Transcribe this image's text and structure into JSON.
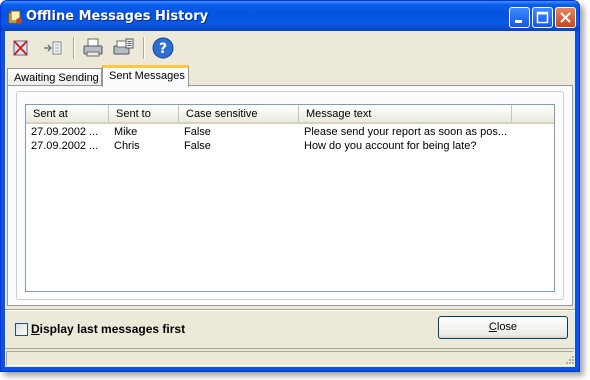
{
  "window": {
    "title": "Offline Messages History"
  },
  "tabs": [
    {
      "label": "Awaiting Sending",
      "active": false
    },
    {
      "label": "Sent Messages",
      "active": true
    }
  ],
  "table": {
    "columns": [
      "Sent at",
      "Sent to",
      "Case sensitive",
      "Message text"
    ],
    "rows": [
      [
        "27.09.2002 ...",
        "Mike",
        "False",
        "Please send your report as soon as pos..."
      ],
      [
        "27.09.2002 ...",
        "Chris",
        "False",
        "How do you account for being late?"
      ]
    ]
  },
  "options": {
    "display_last_first": {
      "label": "Display last messages first",
      "checked": false
    }
  },
  "buttons": {
    "close": "Close"
  },
  "toolbar": {
    "icons": [
      "delete-icon",
      "resend-icon",
      "print-icon",
      "print-setup-icon",
      "help-icon"
    ]
  },
  "colors": {
    "titlebar": "#0A5EEB",
    "tab_highlight": "#FFC83C",
    "surface": "#ECE9D8"
  }
}
